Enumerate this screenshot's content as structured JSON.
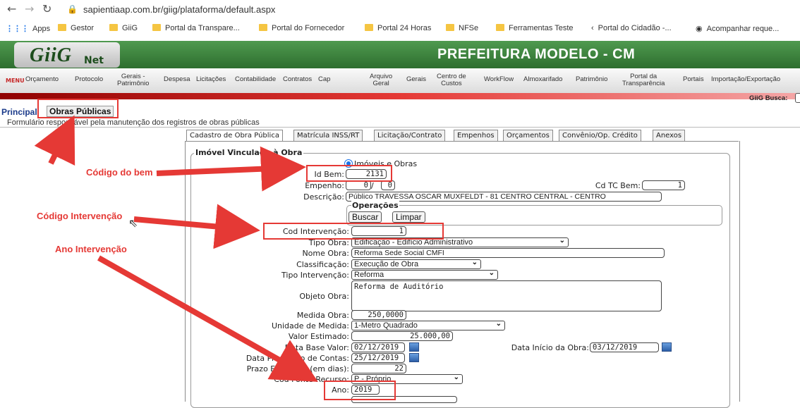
{
  "browser": {
    "url": "sapientiaap.com.br/giig/plataforma/default.aspx",
    "bookmarks": [
      "Apps",
      "Gestor",
      "GiiG",
      "Portal da Transpare...",
      "Portal do Fornecedor",
      "Portal 24 Horas",
      "NFSe",
      "Ferramentas Teste",
      "Portal do Cidadão -...",
      "Acompanhar reque..."
    ]
  },
  "app": {
    "logo": "GiiG",
    "logo_suffix": "Net",
    "title": "PREFEITURA MODELO - CM"
  },
  "menu": {
    "label": "MENU",
    "items": [
      {
        "l1": "Orçamento",
        "l2": ""
      },
      {
        "l1": "Protocolo",
        "l2": ""
      },
      {
        "l1": "Gerais -",
        "l2": "Patrimônio"
      },
      {
        "l1": "Despesa",
        "l2": ""
      },
      {
        "l1": "Licitações",
        "l2": ""
      },
      {
        "l1": "Contabilidade",
        "l2": ""
      },
      {
        "l1": "Contratos",
        "l2": ""
      },
      {
        "l1": "Cap",
        "l2": ""
      },
      {
        "l1": "Arquivo",
        "l2": "Geral"
      },
      {
        "l1": "Gerais",
        "l2": ""
      },
      {
        "l1": "Centro de",
        "l2": "Custos"
      },
      {
        "l1": "WorkFlow",
        "l2": ""
      },
      {
        "l1": "Almoxarifado",
        "l2": ""
      },
      {
        "l1": "Patrimônio",
        "l2": ""
      },
      {
        "l1": "Portal da",
        "l2": "Transparência"
      },
      {
        "l1": "Portais",
        "l2": ""
      },
      {
        "l1": "Importação/Exportação",
        "l2": ""
      }
    ],
    "busca_label": "GiiG Busca:"
  },
  "breadcrumb": {
    "parent": "Principal",
    "current": "Obras Públicas"
  },
  "description": "Formulário responsável pela manutenção dos registros de obras públicas",
  "tabs": [
    "Cadastro de Obra Pública",
    "Matrícula INSS/RT",
    "Licitação/Contrato",
    "Empenhos",
    "Orçamentos",
    "Convênio/Op. Crédito",
    "Anexos"
  ],
  "form": {
    "legend": "Imóvel Vinculado à Obra",
    "radio_label": "Imóveis e Obras",
    "id_bem_label": "Id Bem:",
    "id_bem": "2131",
    "empenho_label": "Empenho:",
    "empenho_a": "0",
    "empenho_sep": "/",
    "empenho_b": "0",
    "cd_tc_bem_label": "Cd TC Bem:",
    "cd_tc_bem": "1",
    "descricao_label": "Descrição:",
    "descricao": "Público TRAVESSA OSCAR MUXFELDT - 81 CENTRO CENTRAL - CENTRO",
    "operacoes_label": "Operações",
    "buscar": "Buscar",
    "limpar": "Limpar",
    "cod_intervencao_label": "Cod Intervenção:",
    "cod_intervencao": "1",
    "tipo_obra_label": "Tipo Obra:",
    "tipo_obra": "Edificação - Edifício Administrativo",
    "nome_obra_label": "Nome Obra:",
    "nome_obra": "Reforma Sede Social CMFI",
    "classificacao_label": "Classificação:",
    "classificacao": "Execução de Obra",
    "tipo_intervencao_label": "Tipo Intervenção:",
    "tipo_intervencao": "Reforma",
    "objeto_obra_label": "Objeto Obra:",
    "objeto_obra": "Reforma de Auditório",
    "medida_obra_label": "Medida Obra:",
    "medida_obra": "250,0000",
    "unidade_medida_label": "Unidade de Medida:",
    "unidade_medida": "1-Metro Quadrado",
    "valor_estimado_label": "Valor Estimado:",
    "valor_estimado": "25.000,00",
    "data_base_label": "Data Base Valor:",
    "data_base": "02/12/2019",
    "data_inicio_label": "Data Início da Obra:",
    "data_inicio": "03/12/2019",
    "prestacao_label": "Data Prestação de Contas:",
    "prestacao": "25/12/2019",
    "prazo_label": "Prazo Execução (em dias):",
    "prazo": "22",
    "cod_fonte_label": "Cod Fonte Recurso:",
    "cod_fonte": "P - Próprio",
    "ano_label": "Ano:",
    "ano": "2019"
  },
  "annotations": {
    "codigo_bem": "Código do bem",
    "codigo_intervencao": "Código Intervenção",
    "ano_intervencao": "Ano Intervenção"
  },
  "colors": {
    "annotation": "#e53935",
    "header_green": "#3a7f3a",
    "menu_red": "#c62828"
  }
}
